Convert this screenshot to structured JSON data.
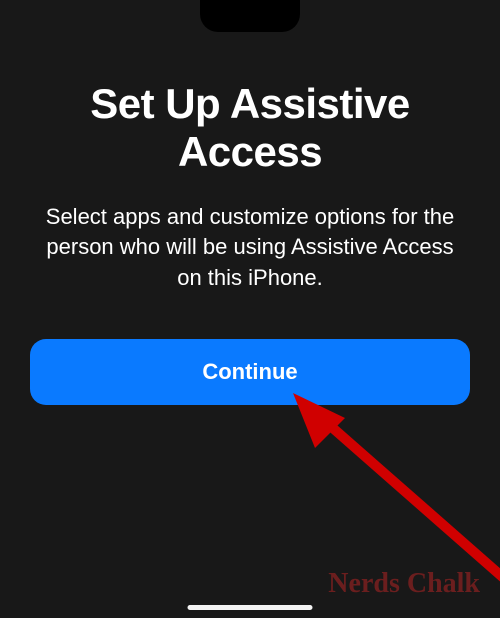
{
  "setup": {
    "title": "Set Up Assistive Access",
    "description": "Select apps and customize options for the person who will be using Assistive Access on this iPhone.",
    "continue_label": "Continue"
  },
  "watermark": {
    "text": "Nerds Chalk"
  }
}
